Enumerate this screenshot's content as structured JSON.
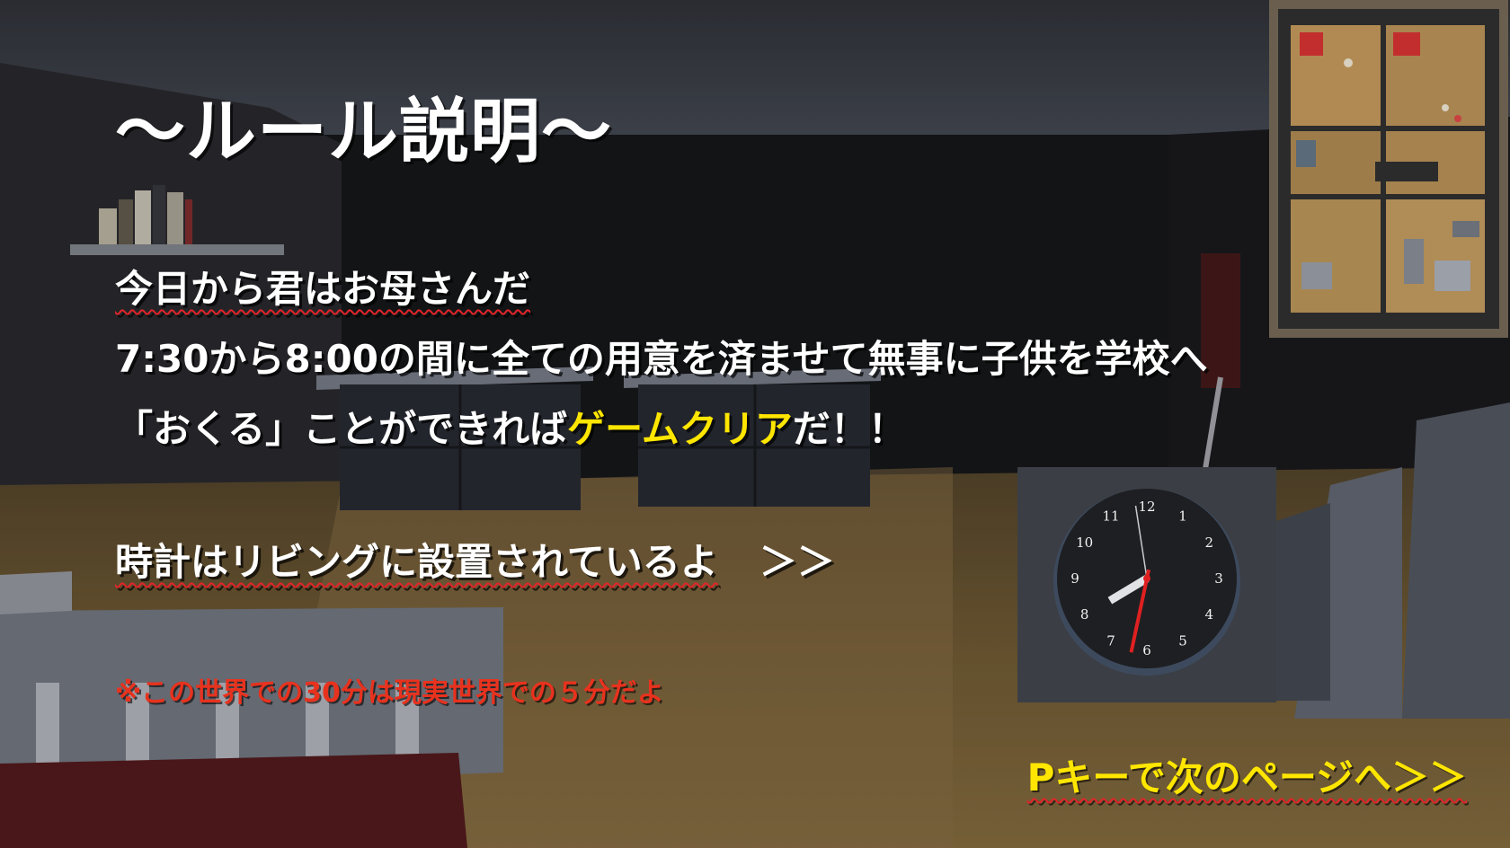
{
  "rules": {
    "title": "〜ルール説明〜",
    "line1": "今日から君はお母さんだ",
    "line2": "7:30から8:00の間に全ての用意を済ませて無事に子供を学校へ",
    "line3_before": "「おくる」ことができれば",
    "line3_highlight": "ゲームクリア",
    "line3_after": "だ！！",
    "line4": "時計はリビングに設置されているよ",
    "line4_arrow": "＞＞",
    "note": "※この世界での30分は現実世界での５分だよ",
    "next_page": "Pキーで次のページへ＞＞"
  },
  "clock": {
    "numbers": [
      "12",
      "1",
      "2",
      "3",
      "4",
      "5",
      "6",
      "7",
      "8",
      "9",
      "10",
      "11"
    ],
    "time": {
      "hour": 7,
      "minute": 58,
      "second": 32
    }
  },
  "minimap": {
    "label": "minimap"
  },
  "colors": {
    "text": "#ffffff",
    "highlight": "#ffe600",
    "note": "#e8321e",
    "squiggle": "#e0262a",
    "clock_face": "#1e1f22",
    "second_hand": "#e02020"
  }
}
